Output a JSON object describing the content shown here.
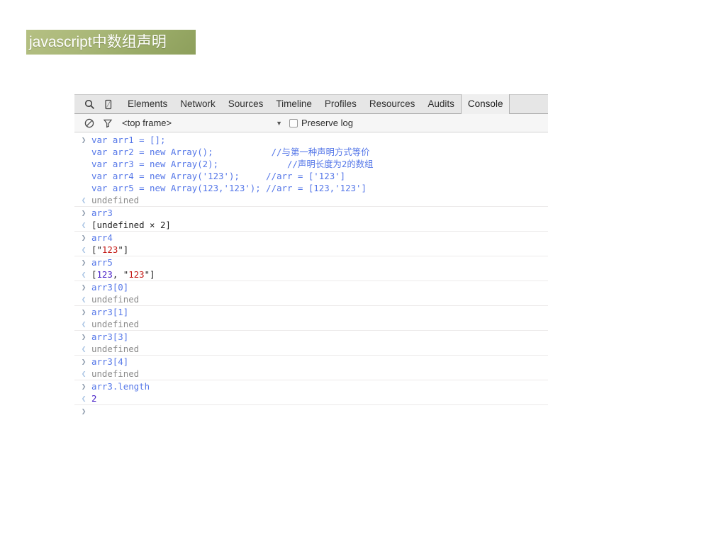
{
  "slide": {
    "title": "javascript中数组声明",
    "title_bg_from": "#b5c083",
    "title_bg_to": "#8d9f5c",
    "title_color": "#ffffff"
  },
  "devtools": {
    "toolbar": {
      "search_icon": "search-icon",
      "device_icon": "device-toggle-icon",
      "tabs": [
        {
          "label": "Elements",
          "selected": false
        },
        {
          "label": "Network",
          "selected": false
        },
        {
          "label": "Sources",
          "selected": false
        },
        {
          "label": "Timeline",
          "selected": false
        },
        {
          "label": "Profiles",
          "selected": false
        },
        {
          "label": "Resources",
          "selected": false
        },
        {
          "label": "Audits",
          "selected": false
        },
        {
          "label": "Console",
          "selected": true
        }
      ]
    },
    "filterbar": {
      "clear_icon": "clear-console-icon",
      "filter_icon": "filter-funnel-icon",
      "frame_value": "<top frame>",
      "frame_caret": "▼",
      "preserve_log_label": "Preserve log",
      "preserve_log_checked": false
    },
    "console": {
      "input_marker": "❯",
      "output_marker": "❮",
      "accent_input": "#5577e8",
      "accent_string": "#c41a16",
      "accent_number": "#4b23c8",
      "accent_undefined": "#8c8c8c",
      "entries": [
        {
          "type": "input-multiline",
          "lines": [
            "var arr1 = [];",
            "var arr2 = new Array();           //与第一种声明方式等价",
            "var arr3 = new Array(2);             //声明长度为2的数组",
            "var arr4 = new Array('123');     //arr = ['123']",
            "var arr5 = new Array(123,'123'); //arr = [123,'123']"
          ]
        },
        {
          "type": "output",
          "style": "undefined",
          "text": "undefined"
        },
        {
          "type": "input",
          "text": "arr3"
        },
        {
          "type": "output",
          "style": "plain",
          "text": "[undefined × 2]"
        },
        {
          "type": "input",
          "text": "arr4"
        },
        {
          "type": "output",
          "style": "array-str",
          "prefix": "[\"",
          "value": "123",
          "suffix": "\"]"
        },
        {
          "type": "input",
          "text": "arr5"
        },
        {
          "type": "output",
          "style": "array-mixed",
          "open": "[",
          "num": "123",
          "mid": ", \"",
          "str": "123",
          "close": "\"]"
        },
        {
          "type": "input",
          "text": "arr3[0]"
        },
        {
          "type": "output",
          "style": "undefined",
          "text": "undefined"
        },
        {
          "type": "input",
          "text": "arr3[1]"
        },
        {
          "type": "output",
          "style": "undefined",
          "text": "undefined"
        },
        {
          "type": "input",
          "text": "arr3[3]"
        },
        {
          "type": "output",
          "style": "undefined",
          "text": "undefined"
        },
        {
          "type": "input",
          "text": "arr3[4]"
        },
        {
          "type": "output",
          "style": "undefined",
          "text": "undefined"
        },
        {
          "type": "input",
          "text": "arr3.length"
        },
        {
          "type": "output",
          "style": "number",
          "text": "2"
        },
        {
          "type": "prompt",
          "text": ""
        }
      ]
    }
  }
}
